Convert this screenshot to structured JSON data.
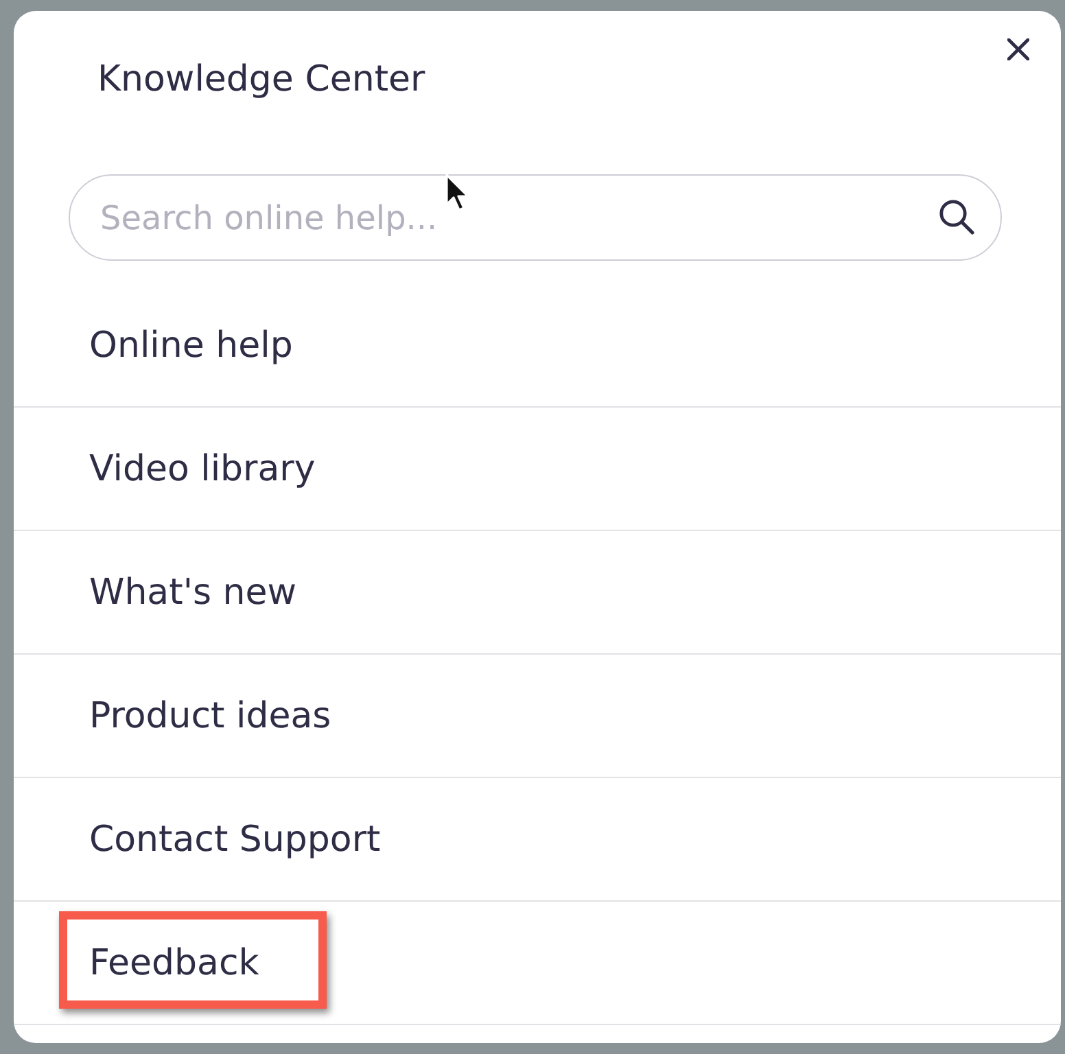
{
  "dialog": {
    "title": "Knowledge Center"
  },
  "search": {
    "placeholder": "Search online help..."
  },
  "items": [
    {
      "label": "Online help",
      "highlighted": false
    },
    {
      "label": "Video library",
      "highlighted": false
    },
    {
      "label": "What's new",
      "highlighted": false
    },
    {
      "label": "Product ideas",
      "highlighted": false
    },
    {
      "label": "Contact Support",
      "highlighted": false
    },
    {
      "label": "Feedback",
      "highlighted": true
    }
  ]
}
